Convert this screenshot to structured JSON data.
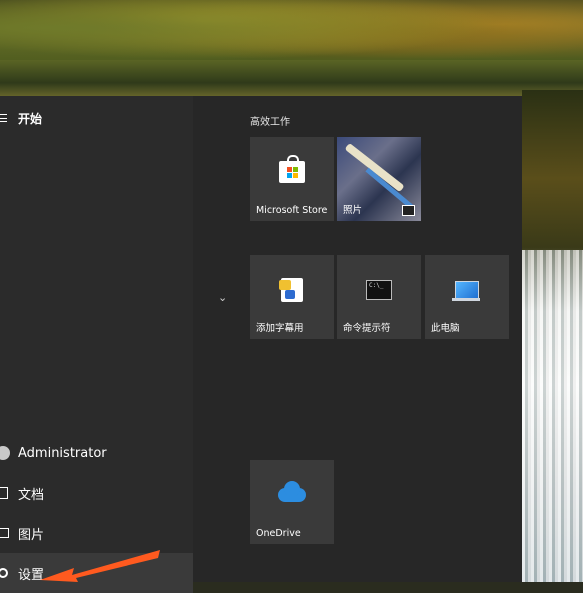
{
  "start_menu": {
    "left_pane": {
      "start_label": "开始",
      "user_name": "Administrator",
      "documents_label": "文档",
      "pictures_label": "图片",
      "settings_label": "设置"
    },
    "group_title": "高效工作",
    "tiles": {
      "store": "Microsoft Store",
      "photos": "照片",
      "caption": "添加字幕用",
      "cmd": "命令提示符",
      "this_pc": "此电脑",
      "onedrive": "OneDrive"
    }
  },
  "colors": {
    "menu_bg": "#272727",
    "tile_bg": "#3a3a3a",
    "annotation_arrow": "#ff5a1f"
  }
}
